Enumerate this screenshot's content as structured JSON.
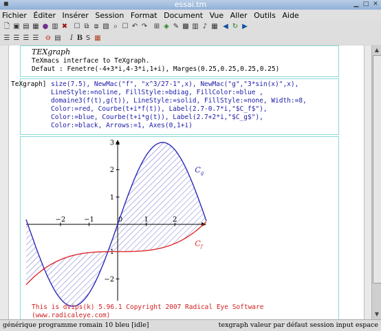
{
  "window": {
    "title": "essai.tm"
  },
  "menu": [
    "Fichier",
    "Éditer",
    "Insérer",
    "Session",
    "Format",
    "Document",
    "Vue",
    "Aller",
    "Outils",
    "Aide"
  ],
  "toolbar": {
    "row1": [
      "new-doc-icon",
      "open-icon",
      "save-icon",
      "print-icon",
      "cut-icon",
      "copy-icon",
      "paste-icon",
      "close-icon",
      "spell-icon",
      "find-icon",
      "replace-icon",
      "undo-icon",
      "redo-icon",
      "table-icon",
      "link-icon",
      "image-icon",
      "sound-icon",
      "calc-icon",
      "help-icon",
      "back-icon",
      "refresh-icon",
      "forward-icon"
    ],
    "row2": [
      "align-left-icon",
      "align-center-icon",
      "align-right-icon",
      "justify-icon",
      "stop-icon",
      "exec-icon",
      "italic",
      "bold",
      "sans",
      "color-icon"
    ],
    "italic_label": "I",
    "bold_label": "B",
    "sans_label": "S"
  },
  "session": {
    "logo": "TEXgraph",
    "banner_1": "TeXmacs interface to TeXgraph.",
    "banner_2": "Defaut : Fenetre(-4+3*i,4-3*i,1+i), Marges(0.25,0.25,0.25,0.25)",
    "prompt": "TeXgraph]",
    "input_lines": [
      "size(7.5), NewMac(\"f\", \"x^3/27-1\",x), NewMac(\"g\",\"3*sin(x)\",x),",
      "LineStyle:=noline, FillStyle:=bdiag, FillColor:=blue ,",
      "domaine3(f(t),g(t)), LineStyle:=solid, FillStyle:=none, Width:=8,",
      "Color:=red, Courbe(t+i*f(t)), Label(2.7-0.7*i,\"$C_f$\"),",
      "Color:=blue, Courbe(t+i*g(t)), Label(2.7+2*i,\"$C_g$\"),",
      "Color:=black, Arrows:=1, Axes(0,1+i)"
    ],
    "output_lines": [
      "This is dvips(k) 5.96.1 Copyright 2007 Radical Eye Software",
      "(www.radicaleye.com)"
    ]
  },
  "chart_data": {
    "type": "line",
    "xlim": [
      -3.2,
      3.1
    ],
    "ylim": [
      -2.8,
      3.1
    ],
    "xticks": [
      "−2",
      "−1",
      "0",
      "1",
      "2"
    ],
    "yticks": [
      "3",
      "2",
      "1",
      "−1",
      "−2"
    ],
    "series": [
      {
        "name": "C_g",
        "formula": "3*sin(x)",
        "color": "#2a2ab8"
      },
      {
        "name": "C_f",
        "formula": "x^3/27-1",
        "color": "#e02828"
      }
    ],
    "labels": {
      "cg": "C",
      "cg_sub": "g",
      "cf": "C",
      "cf_sub": "f"
    },
    "fill": "diagonal hatch between curves, blue"
  },
  "status": {
    "left": "générique programme romain 10 bleu [idle]",
    "right": "texgraph valeur par défaut session input espace"
  }
}
